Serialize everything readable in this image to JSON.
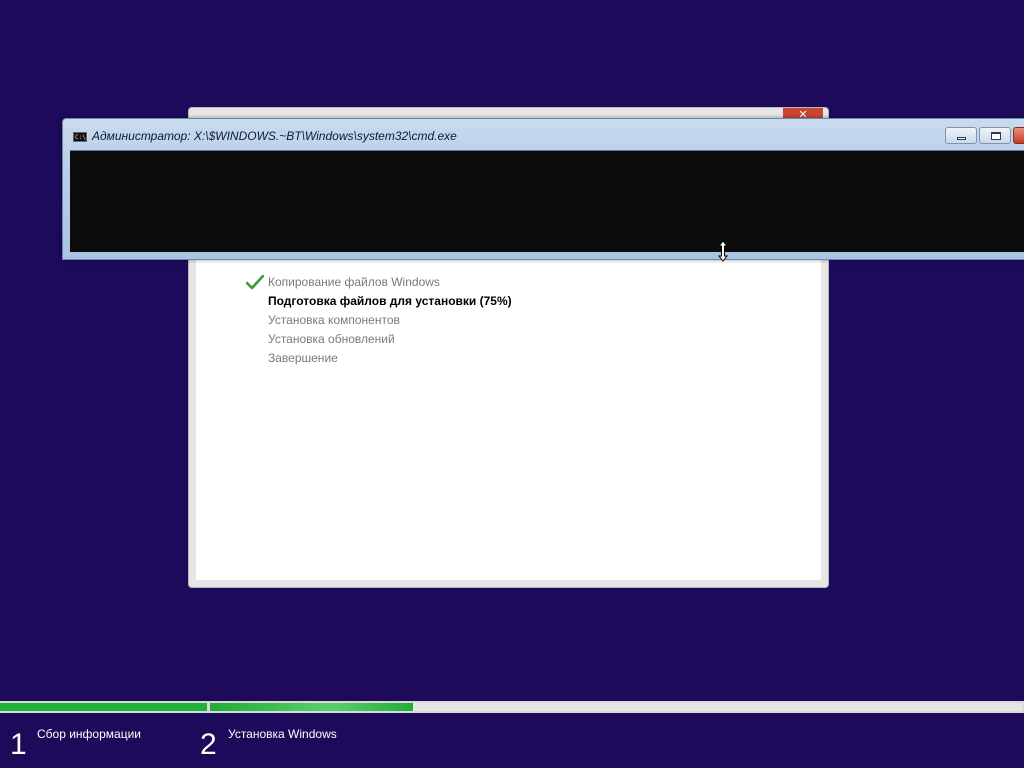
{
  "setup": {
    "close_glyph": "✕",
    "steps": [
      {
        "label": "Копирование файлов Windows",
        "state": "done"
      },
      {
        "label": "Подготовка файлов для установки (75%)",
        "state": "current",
        "progress": "75%"
      },
      {
        "label": "Установка компонентов",
        "state": "pending"
      },
      {
        "label": "Установка обновлений",
        "state": "pending"
      },
      {
        "label": "Завершение",
        "state": "pending"
      }
    ]
  },
  "cmd": {
    "title": "Администратор: X:\\$WINDOWS.~BT\\Windows\\system32\\cmd.exe",
    "icon_text": "C:\\",
    "icon": "console-icon",
    "buttons": {
      "minimize": "minimize-icon",
      "maximize": "maximize-icon",
      "close": "close-icon"
    }
  },
  "bottom": {
    "stages": [
      {
        "number": "1",
        "label": "Сбор информации",
        "fill": 1.0
      },
      {
        "number": "2",
        "label": "Установка Windows",
        "fill": 0.25
      }
    ]
  },
  "colors": {
    "background": "#1d0a5a",
    "progress_green": "#1fb23a",
    "check_green": "#3a9a3a"
  }
}
